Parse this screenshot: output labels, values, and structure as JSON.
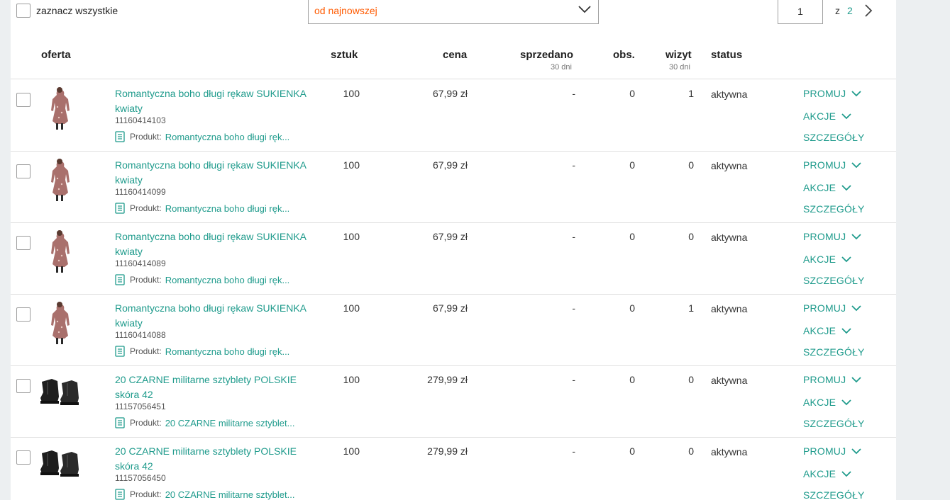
{
  "toolbar": {
    "select_all_label": "zaznacz wszystkie",
    "sort_value": "od najnowszej",
    "page_current": "1",
    "page_of": "z",
    "page_total": "2"
  },
  "columns": {
    "offer": "oferta",
    "qty": "sztuk",
    "price": "cena",
    "sold": "sprzedano",
    "sold_sub": "30 dni",
    "watchers": "obs.",
    "visits": "wizyt",
    "visits_sub": "30 dni",
    "status": "status"
  },
  "labels": {
    "product_prefix": "Produkt:",
    "promote": "PROMUJ",
    "actions": "AKCJE",
    "details": "SZCZEGÓŁY"
  },
  "colors": {
    "accent": "#1f9b8c",
    "sort_text": "#ff5a00"
  },
  "rows": [
    {
      "image": "dress-image",
      "title": "Romantyczna boho długi rękaw SUKIENKA kwiaty",
      "id": "11160414103",
      "product": "Romantyczna boho długi ręk...",
      "qty": "100",
      "price": "67,99 zł",
      "sold": "-",
      "watchers": "0",
      "visits": "1",
      "status": "aktywna"
    },
    {
      "image": "dress-image",
      "title": "Romantyczna boho długi rękaw SUKIENKA kwiaty",
      "id": "11160414099",
      "product": "Romantyczna boho długi ręk...",
      "qty": "100",
      "price": "67,99 zł",
      "sold": "-",
      "watchers": "0",
      "visits": "0",
      "status": "aktywna"
    },
    {
      "image": "dress-image",
      "title": "Romantyczna boho długi rękaw SUKIENKA kwiaty",
      "id": "11160414089",
      "product": "Romantyczna boho długi ręk...",
      "qty": "100",
      "price": "67,99 zł",
      "sold": "-",
      "watchers": "0",
      "visits": "0",
      "status": "aktywna"
    },
    {
      "image": "dress-image",
      "title": "Romantyczna boho długi rękaw SUKIENKA kwiaty",
      "id": "11160414088",
      "product": "Romantyczna boho długi ręk...",
      "qty": "100",
      "price": "67,99 zł",
      "sold": "-",
      "watchers": "0",
      "visits": "1",
      "status": "aktywna"
    },
    {
      "image": "boots-image",
      "title": "20 CZARNE militarne sztyblety POLSKIE skóra 42",
      "id": "11157056451",
      "product": "20 CZARNE militarne sztyblet...",
      "qty": "100",
      "price": "279,99 zł",
      "sold": "-",
      "watchers": "0",
      "visits": "0",
      "status": "aktywna"
    },
    {
      "image": "boots-image",
      "title": "20 CZARNE militarne sztyblety POLSKIE skóra 42",
      "id": "11157056450",
      "product": "20 CZARNE militarne sztyblet...",
      "qty": "100",
      "price": "279,99 zł",
      "sold": "-",
      "watchers": "0",
      "visits": "0",
      "status": "aktywna"
    }
  ]
}
